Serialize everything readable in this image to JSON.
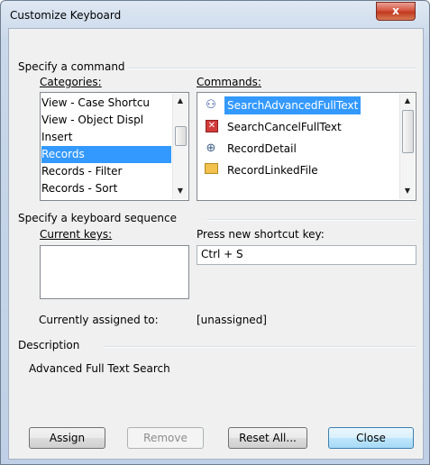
{
  "window": {
    "title": "Customize Keyboard",
    "close_glyph": "x"
  },
  "specify_command": {
    "group_label": "Specify a command",
    "categories_label": "Categories:",
    "categories": [
      "View - Case Shortcu",
      "View - Object Displ",
      "Insert",
      "Records",
      "Records - Filter",
      "Records - Sort"
    ],
    "selected_category": "Records",
    "commands_label": "Commands:",
    "commands": [
      {
        "name": "SearchAdvancedFullText",
        "icon": "binoculars-icon"
      },
      {
        "name": "SearchCancelFullText",
        "icon": "cancel-x-icon"
      },
      {
        "name": "RecordDetail",
        "icon": "magnifier-icon"
      },
      {
        "name": "RecordLinkedFile",
        "icon": "open-folder-icon"
      }
    ],
    "selected_command": "SearchAdvancedFullText"
  },
  "keyboard_sequence": {
    "group_label": "Specify a keyboard sequence",
    "current_keys_label": "Current keys:",
    "new_key_label": "Press new shortcut key:",
    "new_key_value": "Ctrl + S",
    "assigned_label": "Currently assigned to:",
    "assigned_value": "[unassigned]"
  },
  "description": {
    "group_label": "Description",
    "text": "Advanced Full Text Search"
  },
  "buttons": {
    "assign": "Assign",
    "remove": "Remove",
    "reset_all": "Reset All...",
    "close": "Close"
  },
  "scroll_arrows": {
    "up": "▲",
    "down": "▼"
  },
  "colors": {
    "selection": "#3399ff",
    "close_button": "#c0391f"
  }
}
